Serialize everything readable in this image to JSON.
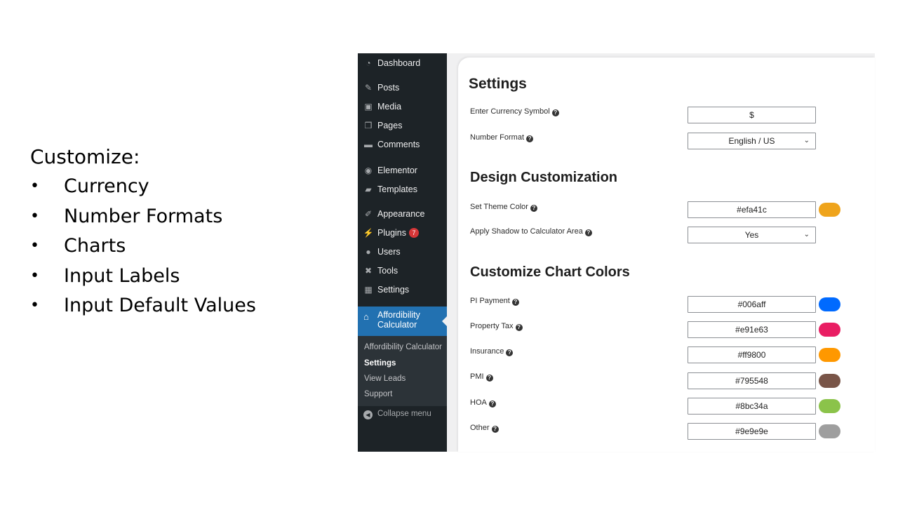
{
  "slide": {
    "heading": "Customize:",
    "bullets": [
      "Currency",
      "Number Formats",
      "Charts",
      "Input Labels",
      "Input Default Values"
    ]
  },
  "sidebar": {
    "items": [
      {
        "label": "Dashboard",
        "icon": "dashboard-icon"
      },
      {
        "label": "Posts",
        "icon": "pin-icon"
      },
      {
        "label": "Media",
        "icon": "media-icon"
      },
      {
        "label": "Pages",
        "icon": "pages-icon"
      },
      {
        "label": "Comments",
        "icon": "comment-icon"
      },
      {
        "label": "Elementor",
        "icon": "elementor-icon"
      },
      {
        "label": "Templates",
        "icon": "folder-icon"
      },
      {
        "label": "Appearance",
        "icon": "brush-icon"
      },
      {
        "label": "Plugins",
        "icon": "plug-icon",
        "badge": "7"
      },
      {
        "label": "Users",
        "icon": "user-icon"
      },
      {
        "label": "Tools",
        "icon": "wrench-icon"
      },
      {
        "label": "Settings",
        "icon": "settings-icon"
      }
    ],
    "active": {
      "label": "Affordibility Calculator",
      "icon": "home-icon"
    },
    "submenu": [
      "Affordibility Calculator",
      "Settings",
      "View Leads",
      "Support"
    ],
    "collapse_label": "Collapse menu"
  },
  "settings": {
    "title": "Settings",
    "currency_label": "Enter Currency Symbol",
    "currency_value": "$",
    "number_format_label": "Number Format",
    "number_format_value": "English / US",
    "design_title": "Design Customization",
    "theme_color_label": "Set Theme Color",
    "theme_color_value": "#efa41c",
    "shadow_label": "Apply Shadow to Calculator Area",
    "shadow_value": "Yes",
    "chart_title": "Customize Chart Colors",
    "chart_colors": [
      {
        "label": "PI Payment",
        "value": "#006aff"
      },
      {
        "label": "Property Tax",
        "value": "#e91e63"
      },
      {
        "label": "Insurance",
        "value": "#ff9800"
      },
      {
        "label": "PMI",
        "value": "#795548"
      },
      {
        "label": "HOA",
        "value": "#8bc34a"
      },
      {
        "label": "Other",
        "value": "#9e9e9e"
      }
    ]
  },
  "colors": {
    "sidebar_bg": "#1d2327",
    "active_bg": "#2271b1",
    "badge": "#d63638"
  }
}
